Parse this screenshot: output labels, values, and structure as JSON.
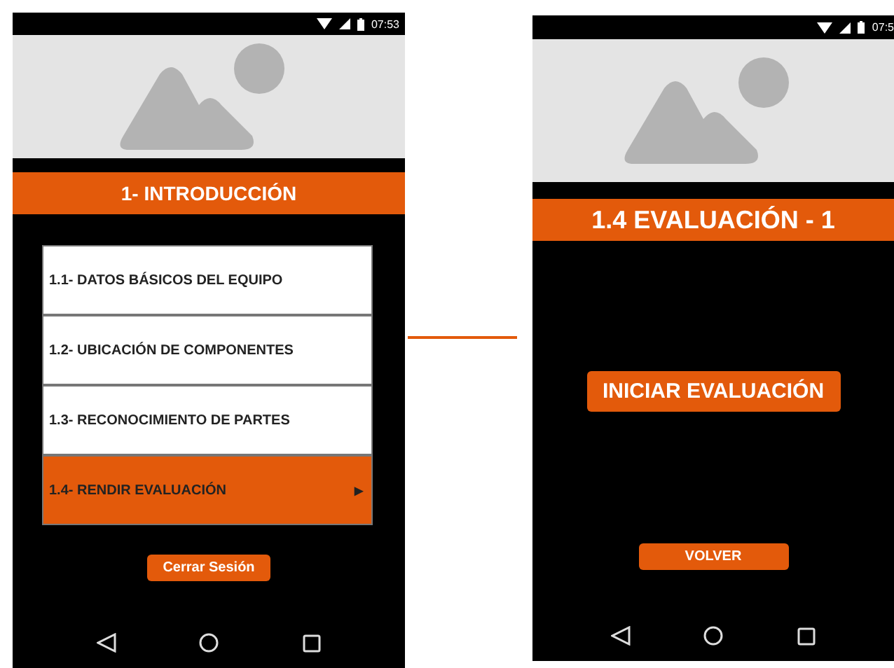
{
  "screens": [
    {
      "status_bar": {
        "time": "07:53"
      },
      "header": "1- INTRODUCCIÓN",
      "menu": [
        {
          "label": "1.1- DATOS BÁSICOS DEL EQUIPO",
          "selected": false
        },
        {
          "label": "1.2- UBICACIÓN DE COMPONENTES",
          "selected": false
        },
        {
          "label": "1.3- RECONOCIMIENTO DE PARTES",
          "selected": false
        },
        {
          "label": "1.4- RENDIR EVALUACIÓN",
          "selected": true,
          "arrow": "▶"
        }
      ],
      "buttons": [
        {
          "label": "Cerrar Sesión",
          "kind": "small"
        }
      ]
    },
    {
      "status_bar": {
        "time": "07:5"
      },
      "header": "1.4 EVALUACIÓN - 1",
      "buttons": [
        {
          "label": "INICIAR EVALUACIÓN",
          "kind": "large"
        },
        {
          "label": "VOLVER",
          "kind": "small"
        }
      ]
    }
  ]
}
